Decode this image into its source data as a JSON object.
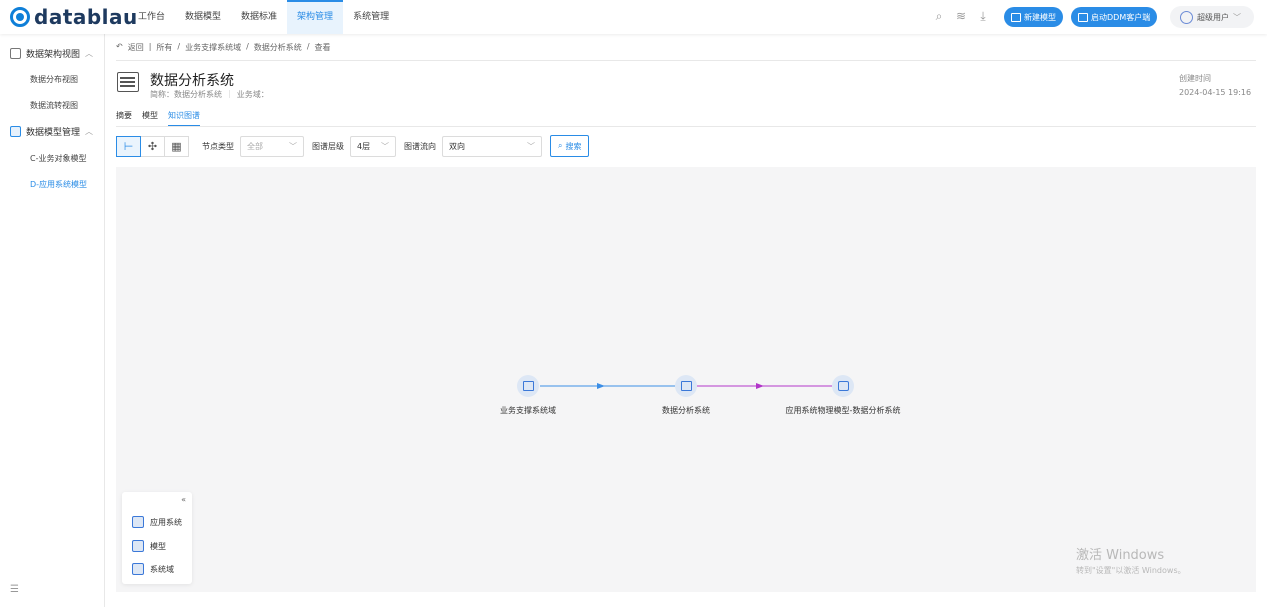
{
  "brand": {
    "name": "datablau"
  },
  "topnav": {
    "items": [
      "工作台",
      "数据模型",
      "数据标准",
      "架构管理",
      "系统管理"
    ],
    "active_index": 3
  },
  "toolbar_top": {
    "new_model": "新建模型",
    "launch_ddm": "启动DDM客户端",
    "user": "超级用户"
  },
  "sidebar": {
    "group1": {
      "label": "数据架构视图"
    },
    "group1_items": [
      "数据分布视图",
      "数据流转视图"
    ],
    "group2": {
      "label": "数据模型管理"
    },
    "group2_items": [
      "C-业务对象模型",
      "D-应用系统模型"
    ]
  },
  "breadcrumb": {
    "back": "返回",
    "sep": "|",
    "path": [
      "所有",
      "业务支撑系统域",
      "数据分析系统",
      "查看"
    ]
  },
  "header": {
    "title": "数据分析系统",
    "short_name_label": "简称：数据分析系统",
    "domain_label": "业务域：",
    "created_label": "创建时间",
    "created_value": "2024-04-15 19:16"
  },
  "tabs": [
    "摘要",
    "模型",
    "知识图谱"
  ],
  "active_tab": 2,
  "filters": {
    "node_type_label": "节点类型",
    "node_type_value": "全部",
    "level_label": "图谱层级",
    "level_value": "4层",
    "direction_label": "图谱流向",
    "direction_value": "双向",
    "search_label": "搜索"
  },
  "graph": {
    "nodes": [
      {
        "label": "业务支撑系统域",
        "icon": "system-domain-icon"
      },
      {
        "label": "数据分析系统",
        "icon": "app-system-icon"
      },
      {
        "label": "应用系统物理模型-数据分析系统",
        "icon": "model-icon"
      }
    ],
    "edge_colors": [
      "#3b8ee6",
      "#b236c9"
    ]
  },
  "legend": {
    "items": [
      {
        "label": "应用系统",
        "icon": "app-system-icon"
      },
      {
        "label": "模型",
        "icon": "model-icon"
      },
      {
        "label": "系统域",
        "icon": "system-domain-icon"
      }
    ]
  },
  "watermark": {
    "line1": "激活 Windows",
    "line2": "转到\"设置\"以激活 Windows。"
  }
}
